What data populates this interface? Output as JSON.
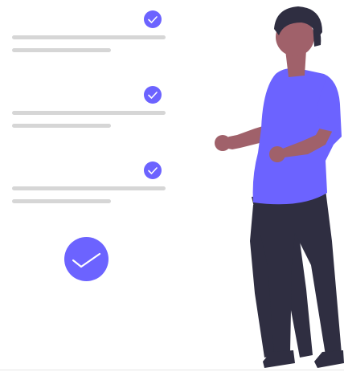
{
  "colors": {
    "accent": "#6c63ff",
    "line_gray": "#d6d6d6",
    "skin": "#a0616a",
    "hair": "#2f2e41",
    "pants": "#2f2e41",
    "shirt": "#6c63ff",
    "shoe": "#2f2e41",
    "check_mark": "#ffffff",
    "ground": "#e6e6e6"
  },
  "checklist": {
    "items": [
      {
        "checked": true,
        "icon": "checkmark-icon"
      },
      {
        "checked": true,
        "icon": "checkmark-icon"
      },
      {
        "checked": true,
        "icon": "checkmark-icon"
      }
    ],
    "completion_icon": "large-checkmark-icon"
  },
  "illustration": {
    "subject": "standing-person-icon"
  }
}
